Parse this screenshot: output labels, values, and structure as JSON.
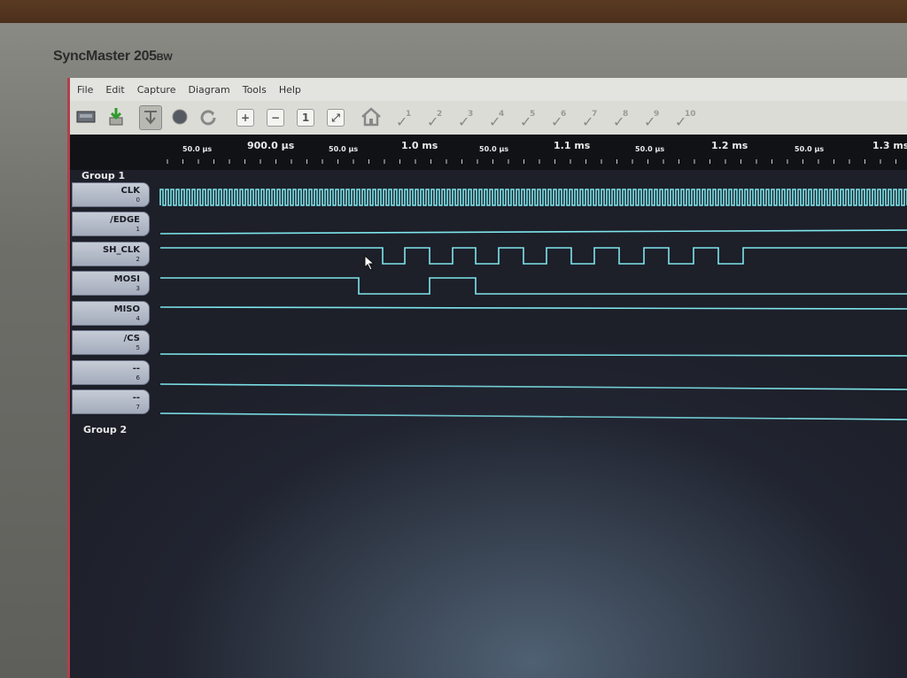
{
  "monitor": {
    "brand": "SyncMaster",
    "model": "205",
    "suffix": "BW"
  },
  "menu": [
    "File",
    "Edit",
    "Capture",
    "Diagram",
    "Tools",
    "Help"
  ],
  "toolbar": {
    "bookmarks": [
      "1",
      "2",
      "3",
      "4",
      "5",
      "6",
      "7",
      "8",
      "9",
      "10"
    ]
  },
  "ruler": {
    "major": [
      "900.0 µs",
      "1.0 ms",
      "1.1 ms",
      "1.2 ms",
      "1.3 ms"
    ],
    "minor": [
      "50.0 µs",
      "50.0 µs",
      "50.0 µs",
      "50.0 µs",
      "50.0 µs"
    ]
  },
  "groups": [
    "Group 1",
    "Group 2"
  ],
  "channels": [
    {
      "name": "CLK",
      "index": "0"
    },
    {
      "name": "/EDGE",
      "index": "1"
    },
    {
      "name": "SH_CLK",
      "index": "2"
    },
    {
      "name": "MOSI",
      "index": "3"
    },
    {
      "name": "MISO",
      "index": "4"
    },
    {
      "name": "/CS",
      "index": "5"
    },
    {
      "name": "--",
      "index": "6"
    },
    {
      "name": "--",
      "index": "7"
    }
  ],
  "colors": {
    "trace": "#7ee6ec",
    "background": "#1d1f29",
    "ruler": "#101216"
  }
}
